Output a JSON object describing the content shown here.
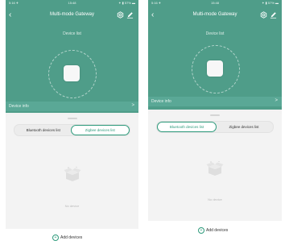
{
  "screens": [
    {
      "status": {
        "left": "5:16 ✈",
        "center": "15:48",
        "right": "✦ ▮ 57% ▬"
      },
      "nav": {
        "title": "Multi-mode Gateway"
      },
      "subtitle": "Device list",
      "info_bar": {
        "label": "Device info",
        "arrow": ">"
      },
      "tabs": [
        {
          "label": "Bluetooth devices list",
          "active": false
        },
        {
          "label": "Zigbee devices list",
          "active": true
        }
      ],
      "empty_text": "No device",
      "add_label": "Add devices"
    },
    {
      "status": {
        "left": "5:16 ✈",
        "center": "15:48",
        "right": "✦ ▮ 57% ▬"
      },
      "nav": {
        "title": "Multi-mode Gateway"
      },
      "subtitle": "Device list",
      "info_bar": {
        "label": "Device info",
        "arrow": ">"
      },
      "tabs": [
        {
          "label": "Bluetooth devices list",
          "active": true
        },
        {
          "label": "Zigbee devices list",
          "active": false
        }
      ],
      "empty_text": "No device",
      "add_label": "Add devices"
    }
  ],
  "colors": {
    "header": "#4f9d89",
    "accent": "#2e9b7c",
    "background": "#f3f3f3"
  },
  "icons": {
    "back": "chevron-left-icon",
    "settings": "gear-icon",
    "edit": "pencil-icon",
    "empty": "empty-box-icon",
    "add": "plus-circle-icon"
  }
}
